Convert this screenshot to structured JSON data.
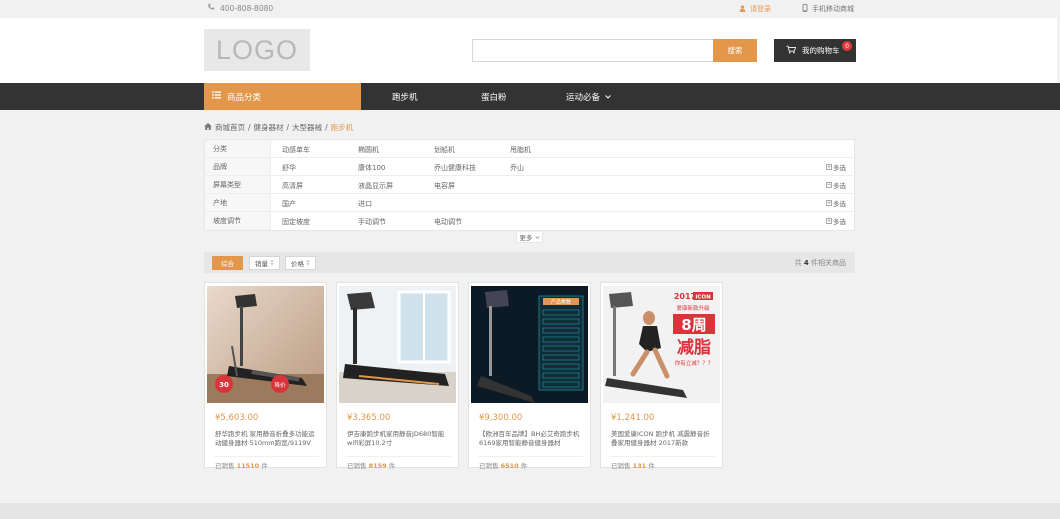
{
  "topbar": {
    "phone": "400-808-8080",
    "login": "请登录",
    "mobile": "手机移动商城"
  },
  "header": {
    "logo": "LOGO",
    "search_placeholder": "",
    "search_button": "搜索",
    "cart_label": "我的购物车",
    "cart_count": "0"
  },
  "nav": {
    "category": "商品分类",
    "items": [
      "跑步机",
      "蛋白粉",
      "运动必备"
    ]
  },
  "breadcrumb": {
    "items": [
      "商城首页",
      "健身器材",
      "大型器械"
    ],
    "current": "跑步机",
    "sep": "/"
  },
  "filters": [
    {
      "name": "分类",
      "options": [
        "动感单车",
        "椭圆机",
        "划船机",
        "甩脂机"
      ],
      "multi": ""
    },
    {
      "name": "品牌",
      "options": [
        "舒华",
        "康体100",
        "乔山健康科技",
        "乔山"
      ],
      "multi": "多选"
    },
    {
      "name": "屏幕类型",
      "options": [
        "高清屏",
        "液晶显示屏",
        "电容屏"
      ],
      "multi": "多选"
    },
    {
      "name": "产地",
      "options": [
        "国产",
        "进口"
      ],
      "multi": "多选"
    },
    {
      "name": "坡度调节",
      "options": [
        "固定坡度",
        "手动调节",
        "电动调节"
      ],
      "multi": "多选"
    }
  ],
  "more_label": "更多",
  "sort": {
    "default": "综合",
    "sales": "销量",
    "price": "价格",
    "total_prefix": "共",
    "total_count": "4",
    "total_suffix": "件相关商品"
  },
  "products": [
    {
      "price": "¥5,603.00",
      "name": "舒华跑步机 家用静音折叠多功能运动健身器材 510mm跑宽/9119V",
      "sold_prefix": "已销售",
      "sold": "11510",
      "sold_suffix": "件"
    },
    {
      "price": "¥3,365.00",
      "name": "伊吉康跑步机家用静音JD680智能wifi彩屏10.2寸",
      "sold_prefix": "已销售",
      "sold": "8159",
      "sold_suffix": "件"
    },
    {
      "price": "¥9,300.00",
      "name": "【欧洲百年品牌】BH必艾奇跑步机6169家用智能静音健身器材",
      "sold_prefix": "已销售",
      "sold": "6510",
      "sold_suffix": "件"
    },
    {
      "price": "¥1,241.00",
      "name": "美国爱康ICON 跑步机 减震静音折叠家用健身器材 2017新款",
      "sold_prefix": "已销售",
      "sold": "131",
      "sold_suffix": "件"
    }
  ],
  "product_badges": {
    "p1_discount": "30",
    "p1_badge2": "降价",
    "p3_screen_title": "产品参数",
    "p4_year": "2017",
    "p4_brand": "ICON",
    "p4_line1": "爱康新款升级",
    "p4_big1": "8周",
    "p4_big2": "减脂",
    "p4_q": "你有立减？？？"
  },
  "colors": {
    "accent": "#e2974a",
    "dark": "#333333",
    "badge": "#e4393c"
  }
}
